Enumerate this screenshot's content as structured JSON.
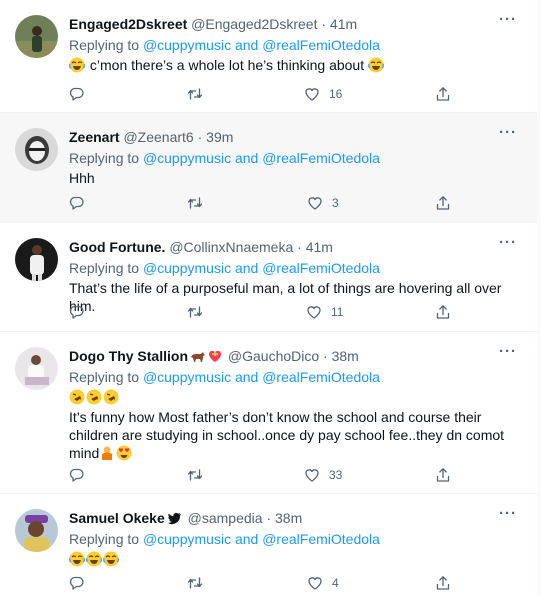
{
  "reply_prefix": "Replying to",
  "mentions": [
    "@cuppymusic",
    "and",
    "@realFemiOtedola"
  ],
  "tweets": [
    {
      "name": "Engaged2Dskreet",
      "handle": "@Engaged2Dskreet",
      "time": "41m",
      "text": "c’mon there’s a whole lot he’s thinking about",
      "replies": "",
      "retweets": "",
      "likes": "16"
    },
    {
      "name": "Zeenart",
      "handle": "@Zeenart6",
      "time": "39m",
      "text": "Hhh",
      "replies": "",
      "retweets": "",
      "likes": "3"
    },
    {
      "name": "Good Fortune.",
      "handle": "@CollinxNnaemeka",
      "time": "41m",
      "text": "That’s the life of a purposeful man, a lot of things are hovering all over him.",
      "replies": "",
      "retweets": "",
      "likes": "11"
    },
    {
      "name": "Dogo Thy Stallion",
      "handle": "@GauchoDico",
      "time": "38m",
      "text": "It’s funny how Most father’s don’t know the school and course their children are studying in school..once dy pay school fee..they dn comot mind",
      "replies": "",
      "retweets": "",
      "likes": "33"
    },
    {
      "name": "Samuel Okeke",
      "handle": "@sampedia",
      "time": "38m",
      "text": "",
      "replies": "",
      "retweets": "",
      "likes": "4"
    }
  ],
  "icons": {
    "reply": "reply-icon",
    "retweet": "retweet-icon",
    "like": "heart-icon",
    "share": "share-icon",
    "more": "more-icon"
  },
  "colors": {
    "link": "#1d9bf0",
    "muted": "#536471",
    "text": "#0f1419",
    "highlight_bg": "#f7f7f7"
  }
}
